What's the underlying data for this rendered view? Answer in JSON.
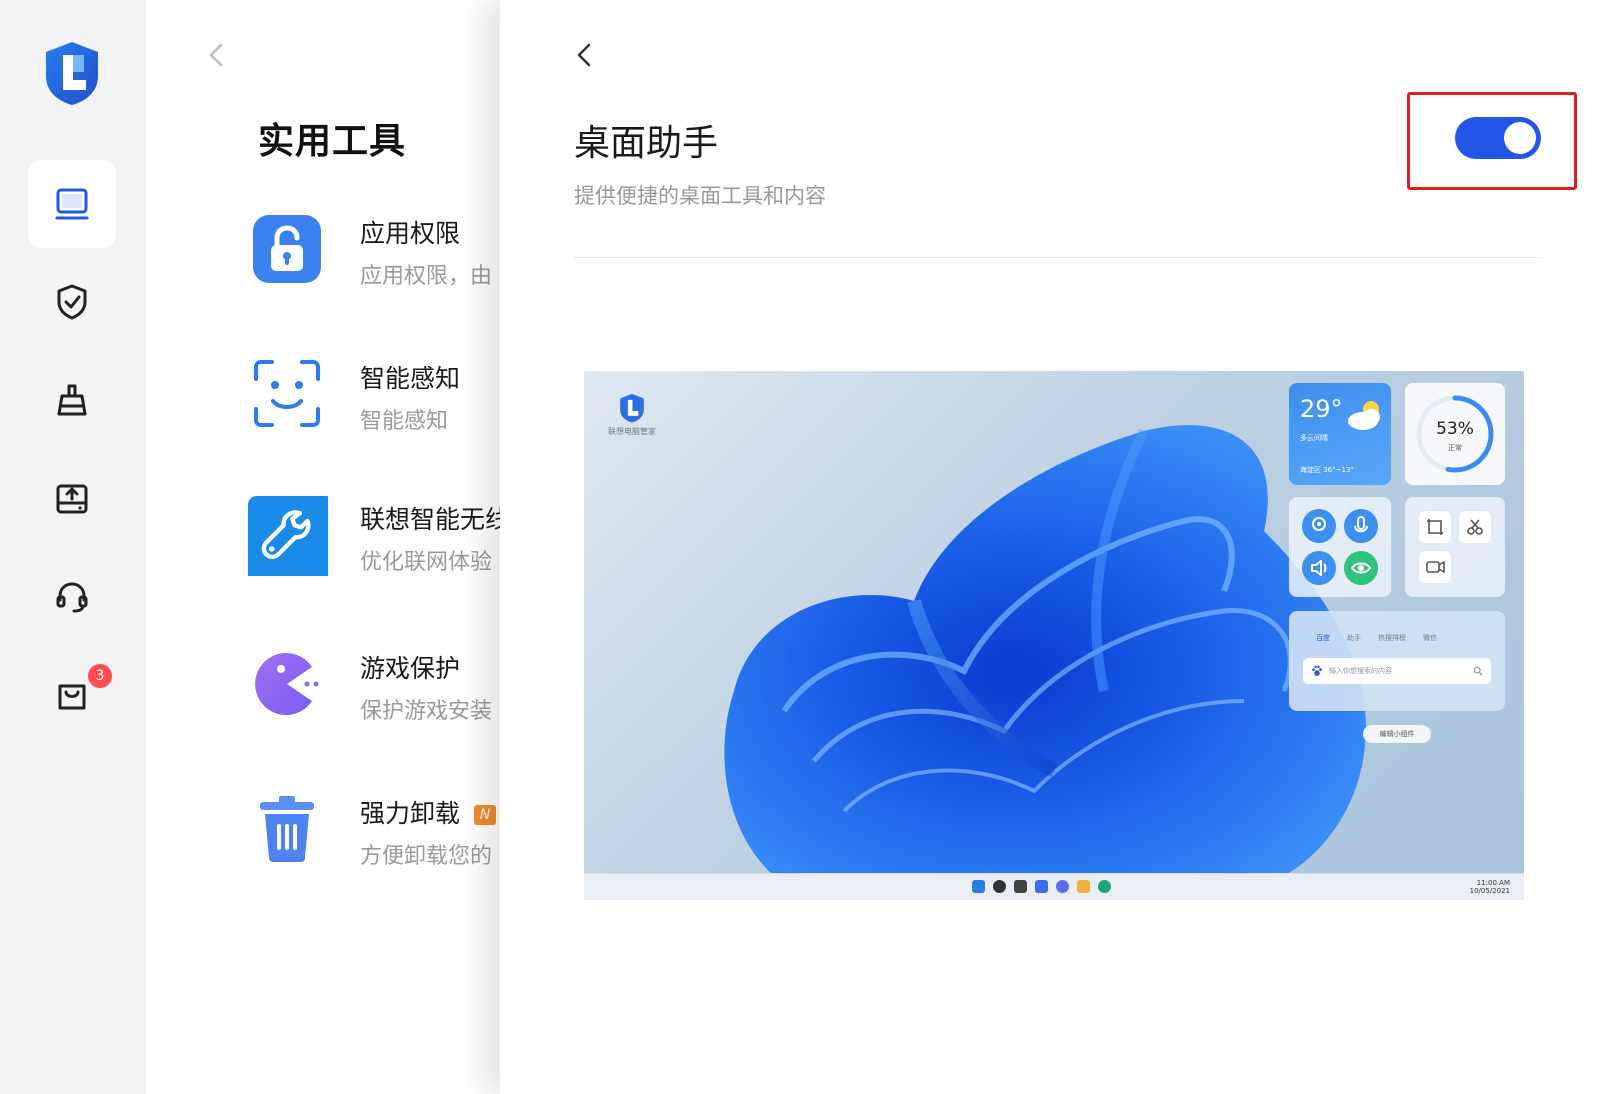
{
  "sidebar": {
    "badge_count": "3"
  },
  "tools_panel": {
    "title": "实用工具",
    "items": [
      {
        "name": "应用权限",
        "desc": "应用权限，由"
      },
      {
        "name": "智能感知",
        "desc": "智能感知"
      },
      {
        "name": "联想智能无线",
        "desc": "优化联网体验"
      },
      {
        "name": "游戏保护",
        "desc": "保护游戏安装"
      },
      {
        "name": "强力卸载",
        "desc": "方便卸载您的",
        "tag": "N"
      }
    ]
  },
  "detail": {
    "title": "桌面助手",
    "subtitle": "提供便捷的桌面工具和内容",
    "toggle_on": true,
    "accent_color": "#2356e8",
    "highlight_color": "#e02020"
  },
  "preview": {
    "logo_caption": "联想电脑管家",
    "weather": {
      "temp": "29°",
      "condition": "多云间晴",
      "range": "海淀区  36°~13°"
    },
    "gauge": {
      "value": "53%",
      "label": "正常",
      "fraction": 0.53
    },
    "search_tabs": [
      "百度",
      "助手",
      "热搜排榜",
      "微信"
    ],
    "search_placeholder": "输入你想搜索的内容",
    "edit_widgets": "编辑小组件",
    "clock_time": "11:00 AM",
    "clock_date": "10/05/2021"
  }
}
